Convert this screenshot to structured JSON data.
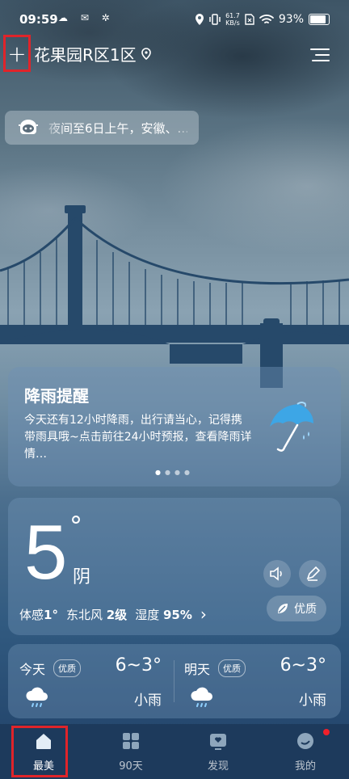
{
  "status": {
    "time": "09:59",
    "left_icons": "☁ ✉ ✲",
    "net_speed_value": "61.7",
    "net_speed_unit": "KB/s",
    "battery": "93%"
  },
  "header": {
    "add_label": "+",
    "location": "花果园R区1区"
  },
  "alert": {
    "text": "夜间至6日上午，安徽、..."
  },
  "rain_card": {
    "title": "降雨提醒",
    "description": "今天还有12小时降雨，出行请当心，记得携带雨具哦~点击前往24小时预报，查看降雨详情…",
    "page_count": 4,
    "active_page": 1
  },
  "now": {
    "temperature": "5",
    "degree": "°",
    "condition": "阴",
    "feels_label": "体感",
    "feels_value": "1°",
    "wind_label": "东北风",
    "wind_value": "2级",
    "humidity_label": "湿度",
    "humidity_value": "95%",
    "chevron": "›",
    "aqi": "优质"
  },
  "forecast": [
    {
      "day": "今天",
      "aqi": "优质",
      "temp": "6~3°",
      "condition": "小雨"
    },
    {
      "day": "明天",
      "aqi": "优质",
      "temp": "6~3°",
      "condition": "小雨"
    }
  ],
  "tabs": [
    {
      "label": "最美"
    },
    {
      "label": "90天"
    },
    {
      "label": "发现"
    },
    {
      "label": "我的"
    }
  ],
  "colors": {
    "highlight_red": "#e0242a",
    "tabbar_bg": "#1d3a5c"
  }
}
